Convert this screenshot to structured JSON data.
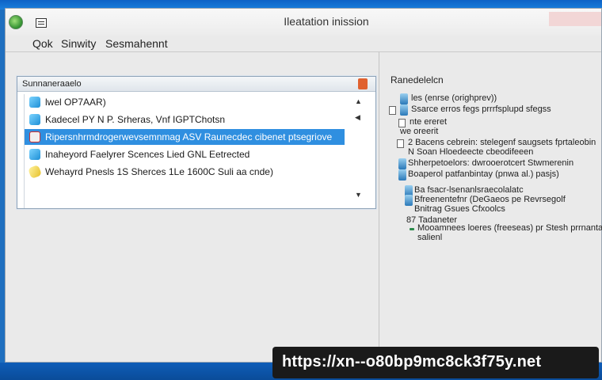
{
  "window": {
    "title": "Ileatation inission"
  },
  "menu": {
    "items": [
      "Qok",
      "Sinwity",
      "Sesmahennt"
    ]
  },
  "list_panel": {
    "header": "Sunnaneraaelo",
    "rows": [
      {
        "text": "lwel OP7AAR)",
        "icon": "app-icon",
        "selected": false
      },
      {
        "text": "Kadecel PY N P. Srheras, Vnf IGPTChotsn",
        "icon": "app-icon",
        "selected": false
      },
      {
        "text": "Ripersnhrmdrogerwevsemnmag ASV Raunecdec cibenet ptsegriove",
        "icon": "document-icon",
        "selected": true
      },
      {
        "text": "Inaheyord Faelyrer Scences Lied GNL Eetrected",
        "icon": "app-icon",
        "selected": false
      },
      {
        "text": "Wehayrd Pnesls 1S Sherces 1Le 1600C Suli aa cnde)",
        "icon": "tag-icon",
        "selected": false
      }
    ]
  },
  "details": {
    "title": "Ranedelelcn",
    "lines": [
      "les (enrse (orighprev))",
      "Ssarce erros fegs prrrfsplupd sfegss",
      "nte ereret",
      "we oreerit",
      "2 Bacens cebrein: stelegenf saugsets fprtaleobin",
      "N Soan Hloedeecte cbeodifeeen",
      "Shherpetoelors: dwrooerotcert Stwmerenin",
      "Boaperol patfanbintay (pnwa al.) pasjs)",
      "Ba fsacr-lsenanlsraecolalatc",
      "Bfreenentefnr (DeGaeos pe Revrsegolf",
      "Bnitrag Gsues Cfxoolcs",
      "87 Tadaneter",
      "Mooamnees loeres (freeseas) pr Stesh prrnantadtabe",
      "salienl"
    ]
  },
  "banner": {
    "url": "https://xn--o80bp9mc8ck3f75y.net"
  }
}
